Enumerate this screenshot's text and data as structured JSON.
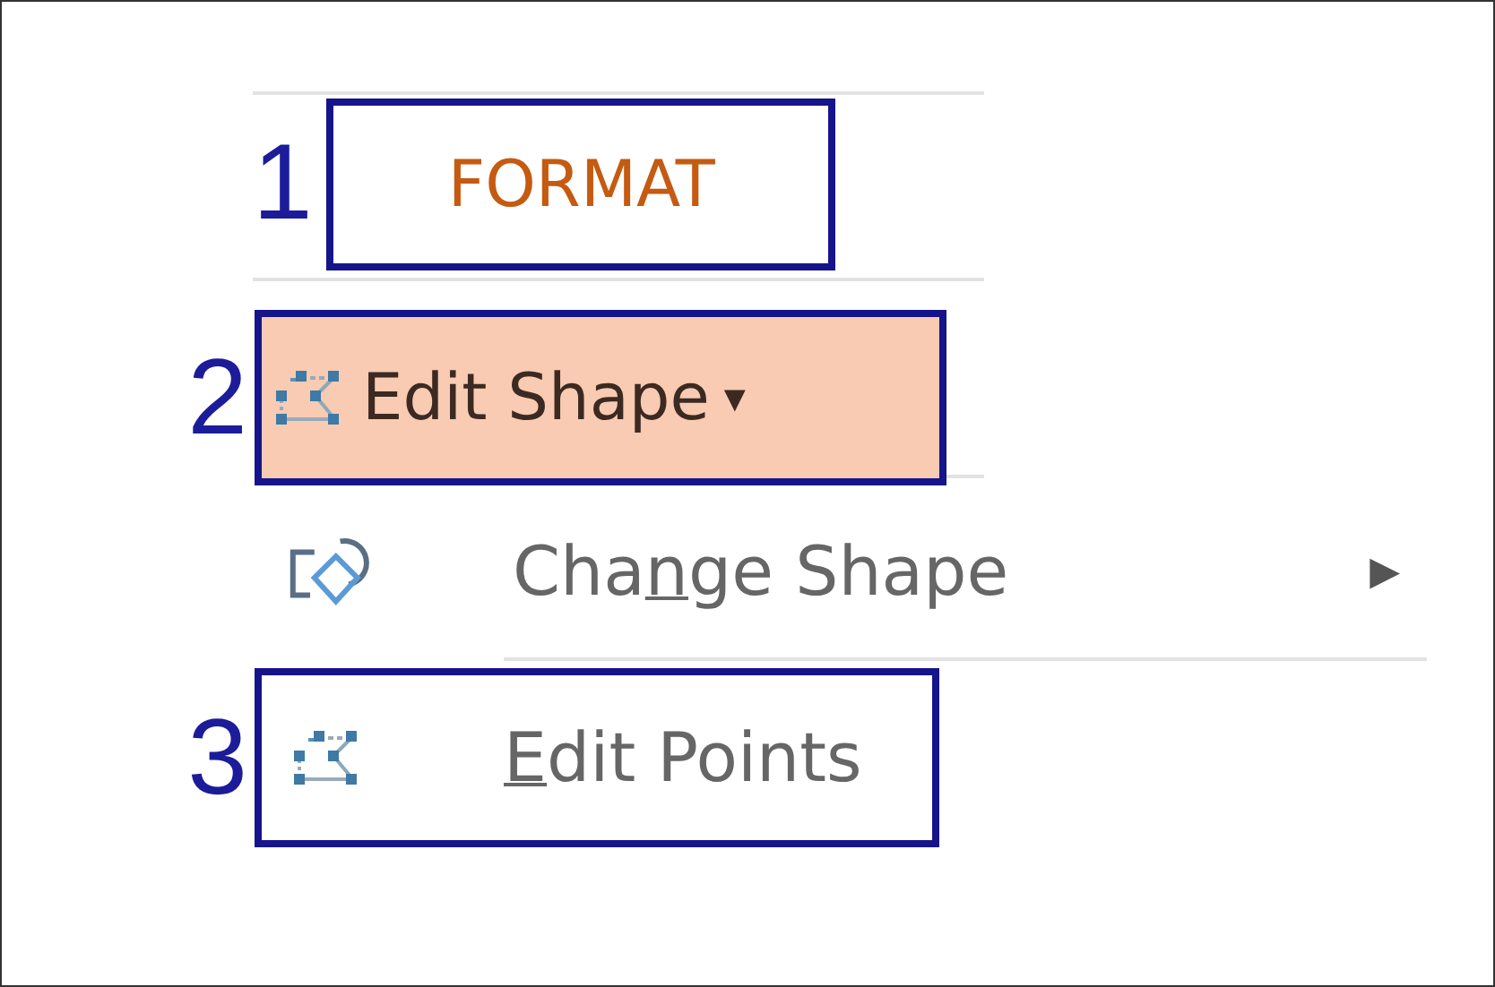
{
  "tab": {
    "label": "FORMAT",
    "annotation": "1"
  },
  "edit_shape_button": {
    "label": "Edit Shape",
    "caret": "▾",
    "highlighted": true,
    "annotation": "2"
  },
  "menu": [
    {
      "kind": "submenu",
      "label_start": "Cha",
      "access_key": "n",
      "label_end": "ge Shape",
      "arrow": "▶"
    },
    {
      "kind": "item",
      "access_key": "E",
      "label_end": "dit Points",
      "annotation": "3"
    }
  ]
}
